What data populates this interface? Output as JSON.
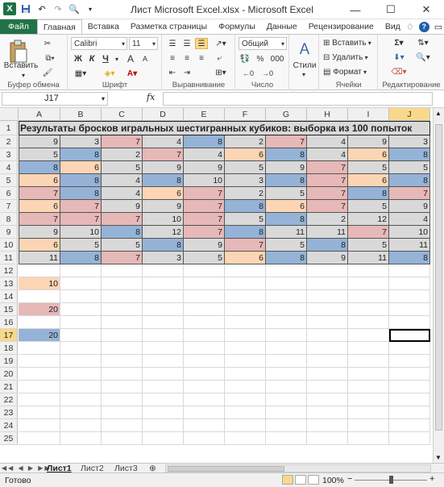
{
  "window": {
    "title": "Лист Microsoft Excel.xlsx  -  Microsoft Excel"
  },
  "tabs": [
    "Файл",
    "Главная",
    "Вставка",
    "Разметка страницы",
    "Формулы",
    "Данные",
    "Рецензирование",
    "Вид"
  ],
  "ribbon": {
    "clipboard": {
      "paste_label": "Вставить",
      "group_label": "Буфер обмена"
    },
    "font": {
      "name": "Calibri",
      "size": "11",
      "bold": "Ж",
      "italic": "К",
      "underline": "Ч",
      "grow": "A",
      "shrink": "A",
      "group_label": "Шрифт"
    },
    "alignment": {
      "group_label": "Выравнивание"
    },
    "number": {
      "format": "Общий",
      "percent": "%",
      "thousands": "000",
      "group_label": "Число"
    },
    "styles": {
      "label": "Стили"
    },
    "cells": {
      "insert": "Вставить",
      "delete": "Удалить",
      "format": "Формат",
      "group_label": "Ячейки"
    },
    "editing": {
      "group_label": "Редактирование"
    }
  },
  "formula_bar": {
    "name_box": "J17",
    "fx": "fx",
    "formula": ""
  },
  "columns": [
    "A",
    "B",
    "C",
    "D",
    "E",
    "F",
    "G",
    "H",
    "I",
    "J"
  ],
  "selected_column": "J",
  "selected_row": 17,
  "sheet_title": "Результаты бросков игральных шестигранных кубиков: выборка из 100 попыток",
  "colors": {
    "grey": "#d9d9d9",
    "orange": "#fcd5b4",
    "blue": "#95b3d7",
    "pink": "#e6b8b7",
    "accent": "#217346"
  },
  "data_rows": [
    {
      "row": 2,
      "values": [
        9,
        3,
        7,
        4,
        8,
        2,
        7,
        4,
        9,
        3
      ],
      "fills": [
        "g",
        "g",
        "p",
        "g",
        "b",
        "g",
        "p",
        "g",
        "g",
        "g"
      ]
    },
    {
      "row": 3,
      "values": [
        5,
        8,
        2,
        7,
        4,
        6,
        8,
        4,
        6,
        8
      ],
      "fills": [
        "g",
        "b",
        "g",
        "p",
        "g",
        "o",
        "b",
        "g",
        "o",
        "b"
      ]
    },
    {
      "row": 4,
      "values": [
        8,
        6,
        5,
        9,
        9,
        5,
        9,
        7,
        5,
        5
      ],
      "fills": [
        "b",
        "o",
        "g",
        "g",
        "g",
        "g",
        "g",
        "p",
        "g",
        "g"
      ]
    },
    {
      "row": 5,
      "values": [
        6,
        8,
        4,
        8,
        10,
        3,
        8,
        7,
        6,
        8
      ],
      "fills": [
        "o",
        "b",
        "g",
        "b",
        "g",
        "g",
        "b",
        "p",
        "o",
        "b"
      ]
    },
    {
      "row": 6,
      "values": [
        7,
        8,
        4,
        6,
        7,
        2,
        5,
        7,
        8,
        7
      ],
      "fills": [
        "p",
        "b",
        "g",
        "o",
        "p",
        "g",
        "g",
        "p",
        "b",
        "p"
      ]
    },
    {
      "row": 7,
      "values": [
        6,
        7,
        9,
        9,
        7,
        8,
        6,
        7,
        5,
        9
      ],
      "fills": [
        "o",
        "p",
        "g",
        "g",
        "p",
        "b",
        "o",
        "p",
        "g",
        "g"
      ]
    },
    {
      "row": 8,
      "values": [
        7,
        7,
        7,
        10,
        7,
        5,
        8,
        2,
        12,
        4
      ],
      "fills": [
        "p",
        "p",
        "p",
        "g",
        "p",
        "g",
        "b",
        "g",
        "g",
        "g"
      ]
    },
    {
      "row": 9,
      "values": [
        9,
        10,
        8,
        12,
        7,
        8,
        11,
        11,
        7,
        10
      ],
      "fills": [
        "g",
        "g",
        "b",
        "g",
        "p",
        "b",
        "g",
        "g",
        "p",
        "g"
      ]
    },
    {
      "row": 10,
      "values": [
        6,
        5,
        5,
        8,
        9,
        7,
        5,
        8,
        5,
        11
      ],
      "fills": [
        "o",
        "g",
        "g",
        "b",
        "g",
        "p",
        "g",
        "b",
        "g",
        "g"
      ]
    },
    {
      "row": 11,
      "values": [
        11,
        8,
        7,
        3,
        5,
        6,
        8,
        9,
        11,
        8
      ],
      "fills": [
        "g",
        "b",
        "p",
        "g",
        "g",
        "o",
        "b",
        "g",
        "g",
        "b"
      ]
    }
  ],
  "summary_cells": [
    {
      "row": 13,
      "value": "10",
      "fill": "o"
    },
    {
      "row": 15,
      "value": "20",
      "fill": "p"
    },
    {
      "row": 17,
      "value": "20",
      "fill": "b"
    }
  ],
  "sheets": [
    "Лист1",
    "Лист2",
    "Лист3"
  ],
  "active_sheet": "Лист1",
  "status": {
    "ready": "Готово",
    "zoom": "100%"
  }
}
